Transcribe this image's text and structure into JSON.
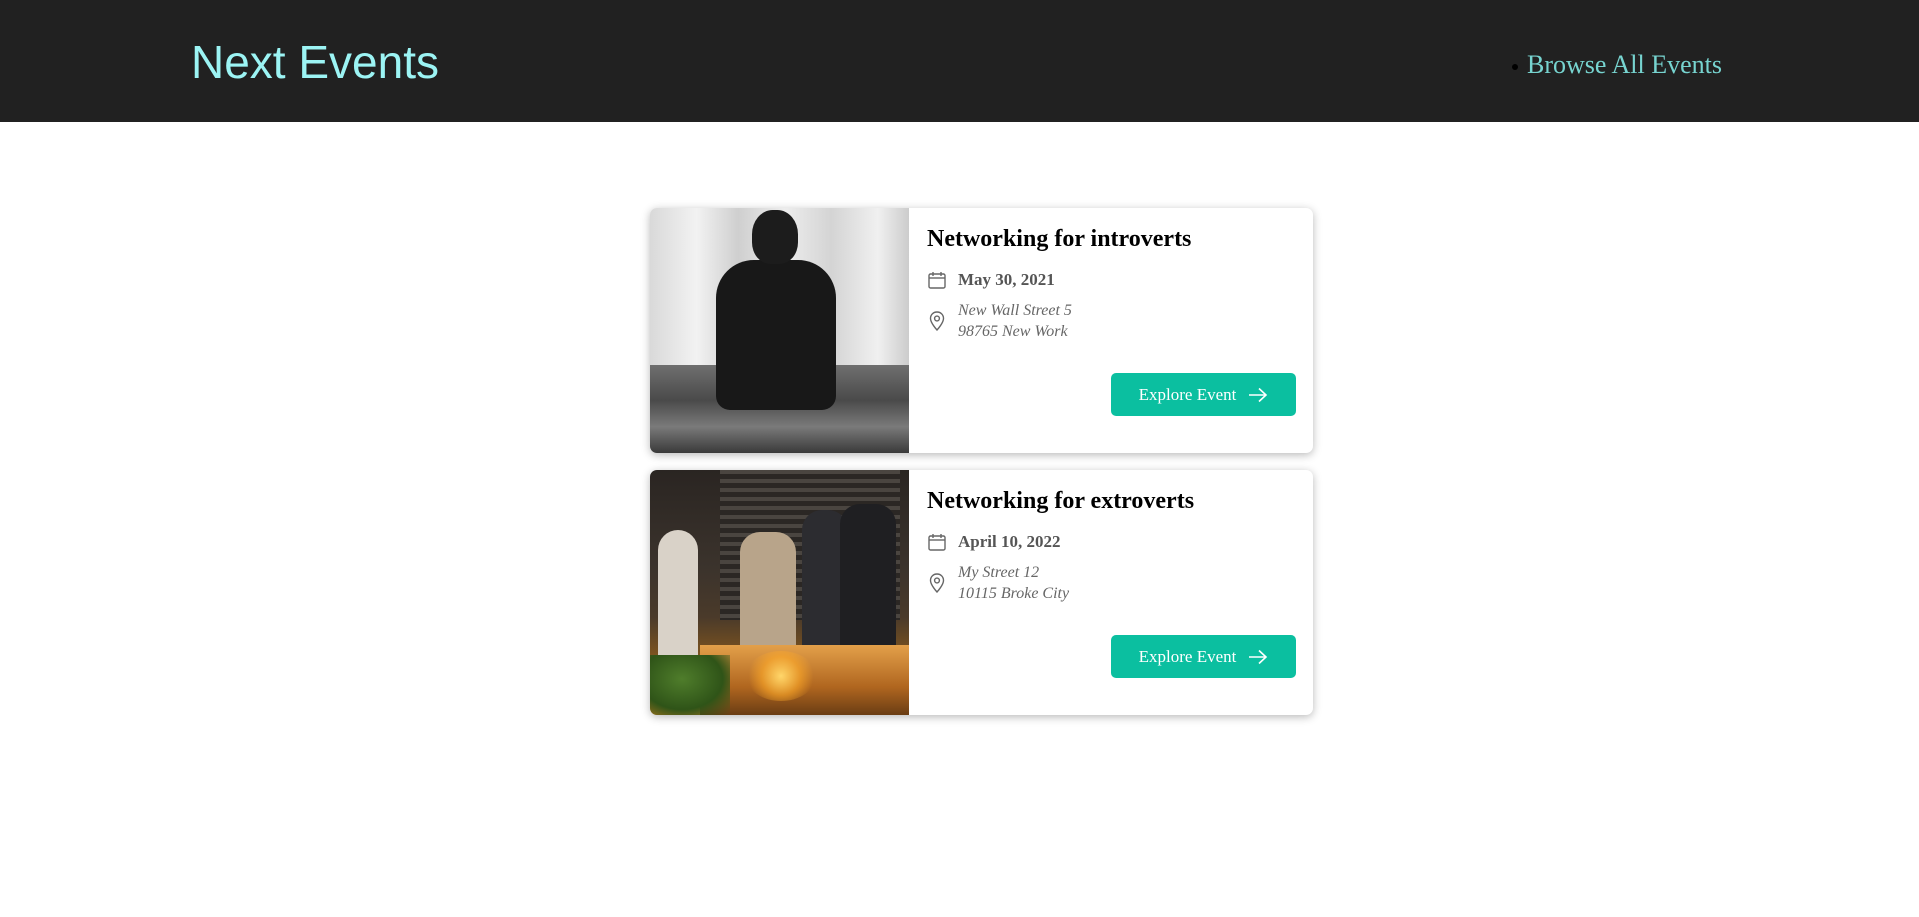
{
  "header": {
    "logo": "Next Events",
    "nav": {
      "browse_label": "Browse All Events"
    }
  },
  "events": [
    {
      "title": "Networking for introverts",
      "date": "May 30, 2021",
      "address_line1": "New Wall Street 5",
      "address_line2": "98765 New Work",
      "button_label": "Explore Event",
      "image_icon": "event-photo-silhouette"
    },
    {
      "title": "Networking for extroverts",
      "date": "April 10, 2022",
      "address_line1": "My Street 12",
      "address_line2": "10115 Broke City",
      "button_label": "Explore Event",
      "image_icon": "event-photo-party"
    }
  ],
  "colors": {
    "header_bg": "#212121",
    "logo": "#9cf4f4",
    "nav_link": "#77d4d0",
    "button_bg": "#0bbfa0"
  }
}
